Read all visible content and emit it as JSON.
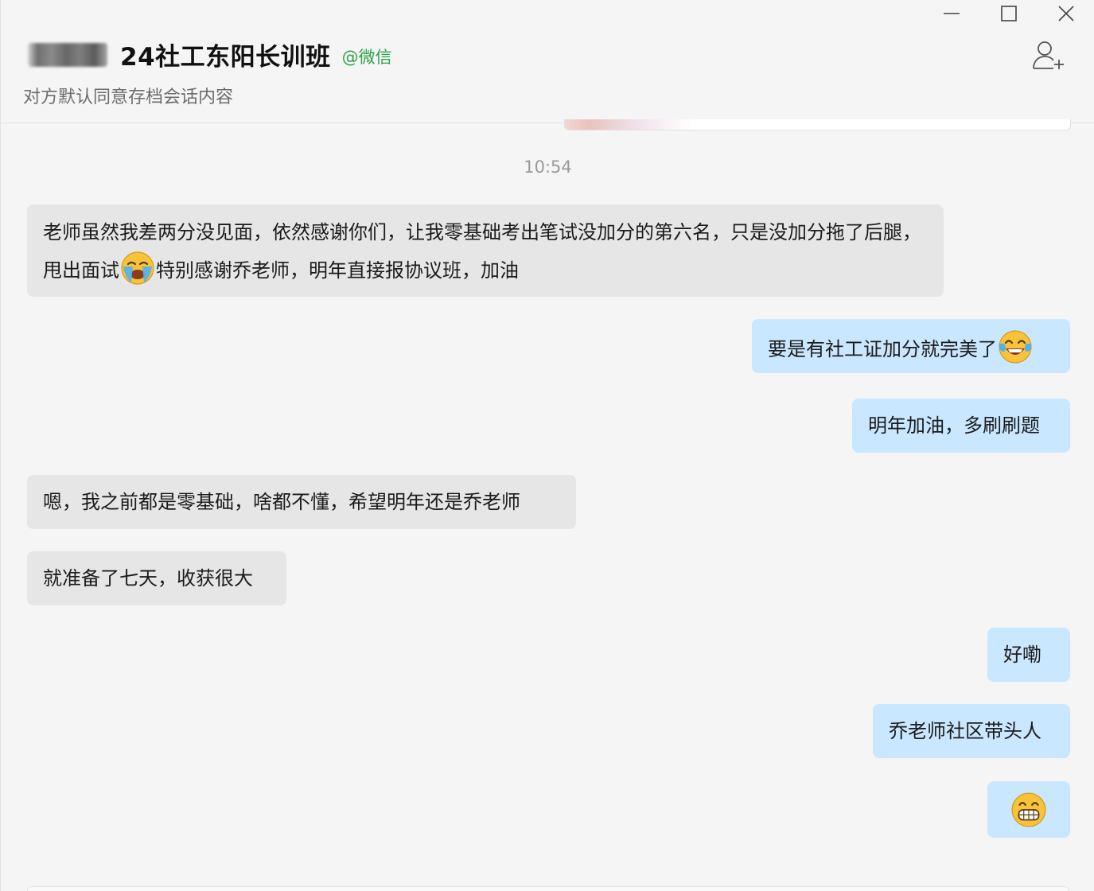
{
  "header": {
    "title": "24社工东阳长训班",
    "platform_tag": "@微信",
    "subtitle": "对方默认同意存档会话内容",
    "controls": [
      "minimize-icon",
      "maximize-icon",
      "close-icon"
    ],
    "add_member_icon": "add-member-icon"
  },
  "chat": {
    "timestamp": "10:54",
    "messages": [
      {
        "side": "in",
        "parts": [
          "老师虽然我差两分没见面，依然感谢你们，让我零基础考出笔试没加分的第六名，只是没加分拖了后腿，甩出面试",
          "特别感谢乔老师，明年直接报协议班，加油"
        ],
        "emoji": "loudly-crying-face"
      },
      {
        "side": "out",
        "text": "要是有社工证加分就完美了",
        "emoji": "tears-of-joy-face"
      },
      {
        "side": "out",
        "text": "明年加油，多刷刷题"
      },
      {
        "side": "in",
        "text": "嗯，我之前都是零基础，啥都不懂，希望明年还是乔老师"
      },
      {
        "side": "in",
        "text": "就准备了七天，收获很大"
      },
      {
        "side": "out",
        "text": "好嘞"
      },
      {
        "side": "out",
        "text": "乔老师社区带头人"
      },
      {
        "side": "out",
        "emoji": "grinning-face"
      }
    ]
  },
  "colors": {
    "incoming_bubble": "#e6e6e6",
    "outgoing_bubble": "#c9e7ff",
    "platform_tag": "#2ba245",
    "background": "#f5f5f5"
  }
}
